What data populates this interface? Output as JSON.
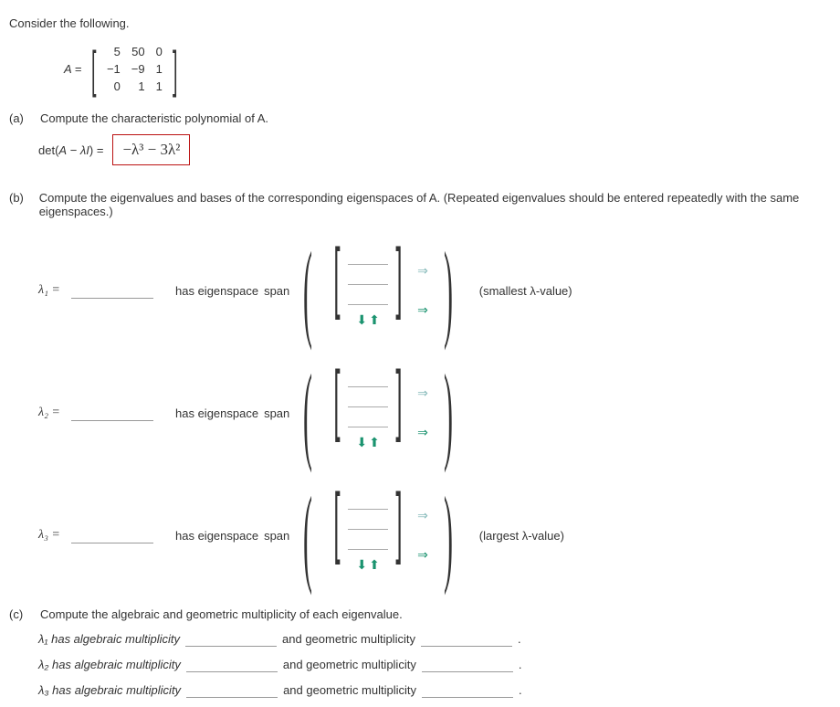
{
  "intro": "Consider the following.",
  "A_label": "A =",
  "matrix": {
    "r1c1": "5",
    "r1c2": "50",
    "r1c3": "0",
    "r2c1": "−1",
    "r2c2": "−9",
    "r2c3": "1",
    "r3c1": "0",
    "r3c2": "1",
    "r3c3": "1"
  },
  "partA": {
    "marker": "(a)",
    "text": "Compute the characteristic polynomial of A.",
    "det_label": "det(A − λI) =",
    "answer": "−λ³ − 3λ²"
  },
  "partB": {
    "marker": "(b)",
    "text": "Compute the eigenvalues and bases of the corresponding eigenspaces of A. (Repeated eigenvalues should be entered repeatedly with the same eigenspaces.)",
    "has_eig": "has eigenspace",
    "span": "span",
    "small": "(smallest λ-value)",
    "large": "(largest λ-value)",
    "lam1": "λ₁ =",
    "lam2": "λ₂ =",
    "lam3": "λ₃ ="
  },
  "partC": {
    "marker": "(c)",
    "text": "Compute the algebraic and geometric multiplicity of each eigenvalue.",
    "l1a": "λ₁ has algebraic multiplicity",
    "l2a": "λ₂ has algebraic multiplicity",
    "l3a": "λ₃ has algebraic multiplicity",
    "and_geo": "and geometric multiplicity",
    "period": "."
  }
}
